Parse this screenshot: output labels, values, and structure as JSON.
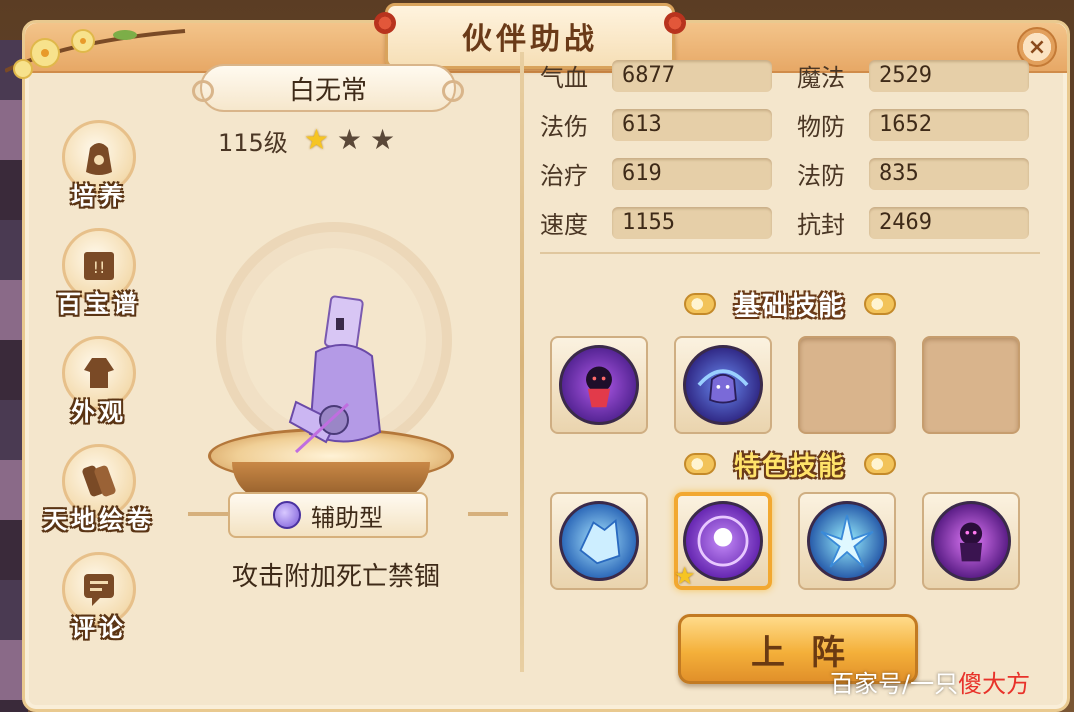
{
  "window": {
    "title": "伙伴助战",
    "close_label": "×"
  },
  "partner": {
    "name": "白无常",
    "level": "115级",
    "stars": {
      "filled": 1,
      "total": 3
    },
    "type": "辅助型",
    "description": "攻击附加死亡禁锢"
  },
  "side_nav": [
    {
      "label": "培养",
      "icon": "bag-icon"
    },
    {
      "label": "百宝谱",
      "icon": "book-icon"
    },
    {
      "label": "外观",
      "icon": "robe-icon"
    },
    {
      "label": "天地绘卷",
      "icon": "scroll-icon"
    },
    {
      "label": "评论",
      "icon": "comment-icon"
    }
  ],
  "stats": [
    {
      "label": "气血",
      "value": "6877"
    },
    {
      "label": "魔法",
      "value": "2529"
    },
    {
      "label": "法伤",
      "value": "613"
    },
    {
      "label": "物防",
      "value": "1652"
    },
    {
      "label": "治疗",
      "value": "619"
    },
    {
      "label": "法防",
      "value": "835"
    },
    {
      "label": "速度",
      "value": "1155"
    },
    {
      "label": "抗封",
      "value": "2469"
    }
  ],
  "basic_skills": {
    "title": "基础技能",
    "slots": [
      {
        "icon": "shadow-imp-skill-icon",
        "empty": false
      },
      {
        "icon": "ghost-vortex-skill-icon",
        "empty": false
      },
      {
        "icon": "",
        "empty": true
      },
      {
        "icon": "",
        "empty": true
      }
    ]
  },
  "special_skills": {
    "title": "特色技能",
    "slots": [
      {
        "icon": "ice-crystal-skill-icon",
        "selected": false
      },
      {
        "icon": "purple-orb-skill-icon",
        "selected": true
      },
      {
        "icon": "ice-burst-skill-icon",
        "selected": false
      },
      {
        "icon": "violet-spirit-skill-icon",
        "selected": false
      }
    ]
  },
  "deploy_button": {
    "label": "上阵"
  },
  "watermark": {
    "text": "百家号/一只",
    "highlight": "傻大方"
  },
  "colors": {
    "panel_bg": "#f4e6cc",
    "title_bar": "#e7a866",
    "accent_gold": "#f4b03a",
    "text_dark": "#3e2a18"
  }
}
